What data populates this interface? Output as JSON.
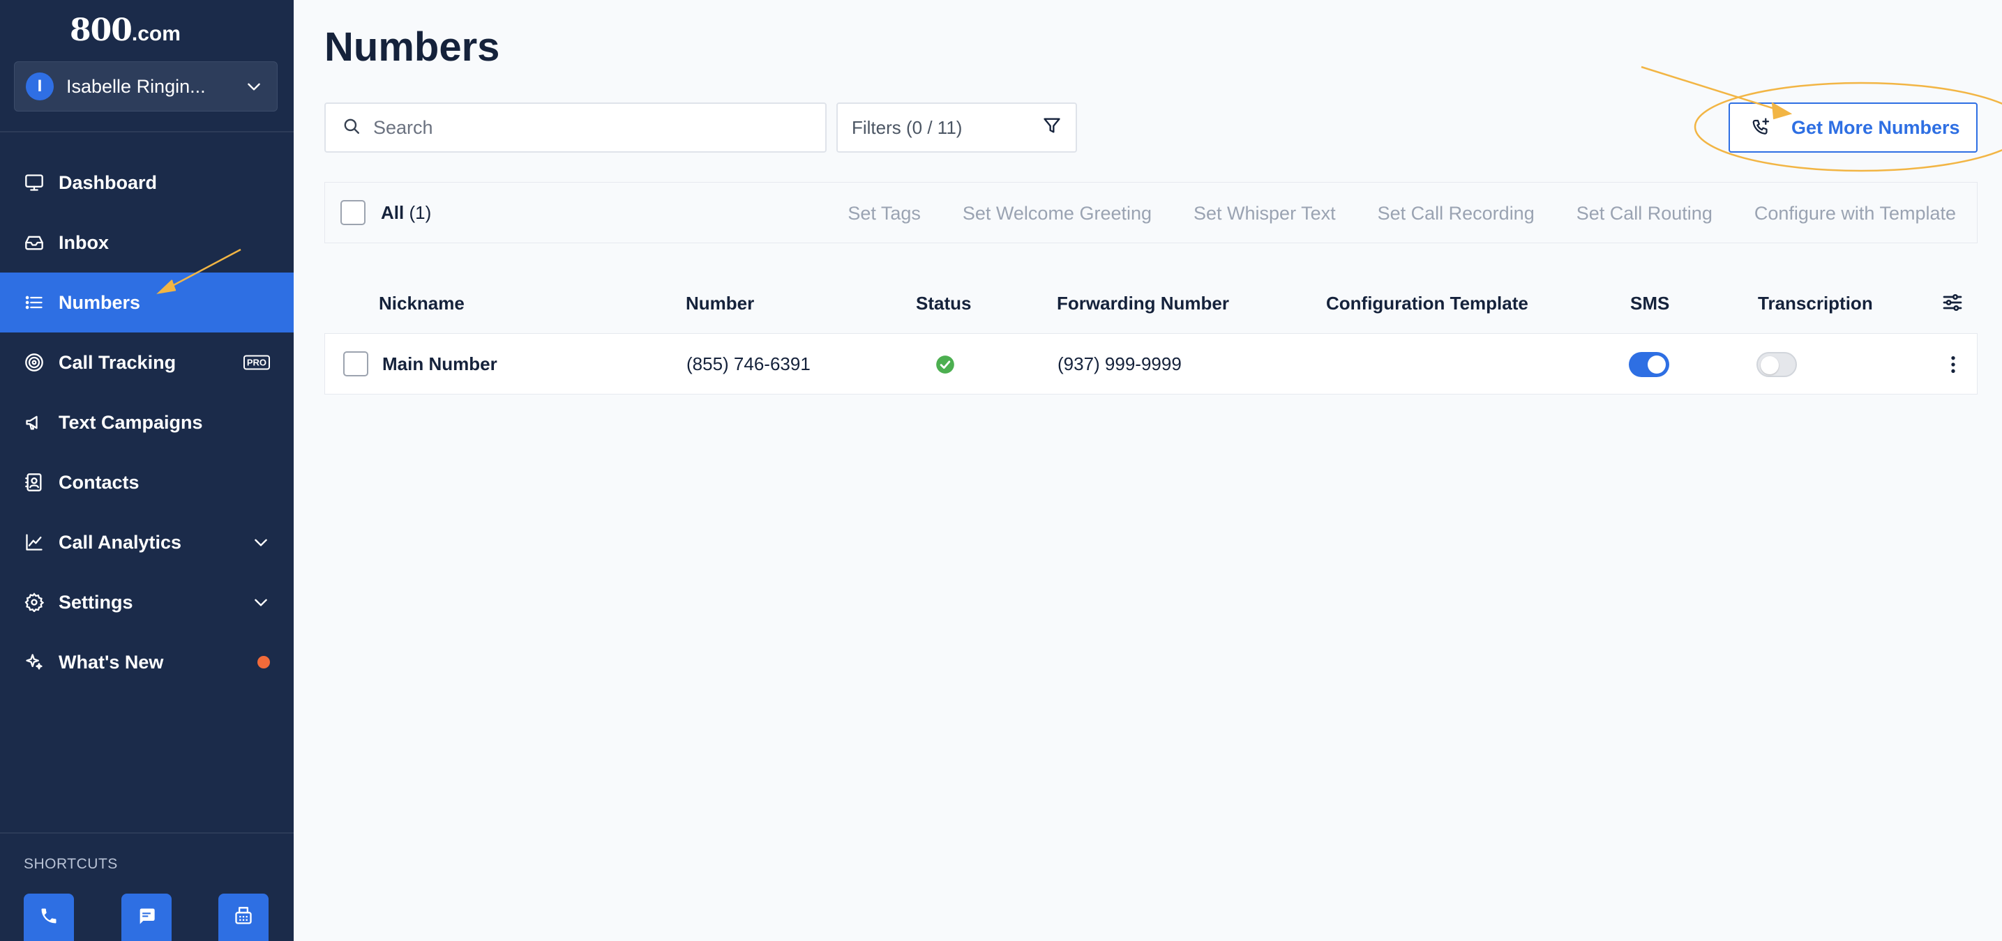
{
  "brand": {
    "logo_main": "800",
    "logo_suffix": ".com"
  },
  "account": {
    "initial": "I",
    "name": "Isabelle Ringin..."
  },
  "nav": {
    "items": [
      {
        "label": "Dashboard",
        "icon": "monitor-icon"
      },
      {
        "label": "Inbox",
        "icon": "inbox-icon"
      },
      {
        "label": "Numbers",
        "icon": "list-icon",
        "active": true
      },
      {
        "label": "Call Tracking",
        "icon": "target-icon",
        "badge": "PRO"
      },
      {
        "label": "Text Campaigns",
        "icon": "megaphone-icon"
      },
      {
        "label": "Contacts",
        "icon": "contacts-icon"
      },
      {
        "label": "Call Analytics",
        "icon": "chart-line-icon",
        "expandable": true
      },
      {
        "label": "Settings",
        "icon": "gear-icon",
        "expandable": true
      },
      {
        "label": "What's New",
        "icon": "sparkle-icon",
        "notification": true
      }
    ]
  },
  "shortcuts": {
    "label": "SHORTCUTS",
    "items": [
      "phone-icon",
      "chat-icon",
      "fax-icon"
    ]
  },
  "page": {
    "title": "Numbers"
  },
  "search": {
    "placeholder": "Search",
    "value": ""
  },
  "filters": {
    "label": "Filters (0 / 11)"
  },
  "get_more": {
    "label": "Get More Numbers"
  },
  "bulk": {
    "all_label": "All",
    "all_count": "(1)",
    "actions": [
      "Set Tags",
      "Set Welcome Greeting",
      "Set Whisper Text",
      "Set Call Recording",
      "Set Call Routing",
      "Configure with Template"
    ]
  },
  "table": {
    "columns": [
      "Nickname",
      "Number",
      "Status",
      "Forwarding Number",
      "Configuration Template",
      "SMS",
      "Transcription"
    ],
    "rows": [
      {
        "nickname": "Main Number",
        "number": "(855) 746-6391",
        "status": "active",
        "forwarding_number": "(937) 999-9999",
        "configuration_template": "",
        "sms": true,
        "transcription": false
      }
    ]
  },
  "colors": {
    "sidebar": "#1b2b4a",
    "accent": "#2e6fe3",
    "status_ok": "#4caf50",
    "notification": "#f26b3a",
    "annotation": "#f2b544"
  }
}
